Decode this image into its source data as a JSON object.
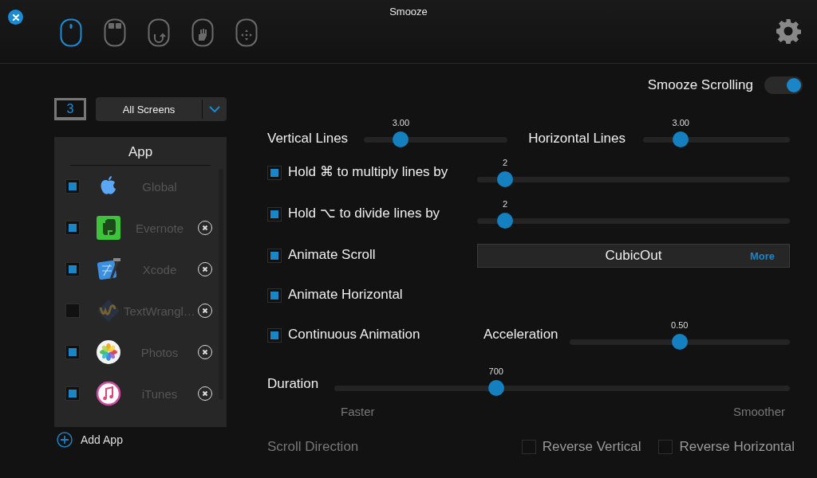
{
  "window": {
    "title": "Smooze"
  },
  "mode_tabs": [
    {
      "kind": "mouse",
      "selected": true
    },
    {
      "kind": "buttons",
      "selected": false
    },
    {
      "kind": "rotate",
      "selected": false
    },
    {
      "kind": "hand",
      "selected": false
    },
    {
      "kind": "move",
      "selected": false
    }
  ],
  "screens": {
    "count": "3",
    "selection": "All Screens"
  },
  "app_list": {
    "header": "App",
    "items": [
      {
        "name": "Global",
        "kind": "apple",
        "checked": true,
        "removable": false
      },
      {
        "name": "Evernote",
        "kind": "evernote",
        "checked": true,
        "removable": true
      },
      {
        "name": "Xcode",
        "kind": "xcode",
        "checked": true,
        "removable": true
      },
      {
        "name": "TextWrangl…",
        "kind": "textwrangler",
        "checked": false,
        "removable": true
      },
      {
        "name": "Photos",
        "kind": "photos",
        "checked": true,
        "removable": true
      },
      {
        "name": "iTunes",
        "kind": "itunes",
        "checked": true,
        "removable": true
      }
    ]
  },
  "add_app": "Add App",
  "smooze_scrolling": {
    "label": "Smooze Scrolling",
    "on": true
  },
  "vertical_lines": {
    "label": "Vertical Lines",
    "reading": "3.00",
    "level": 0.23
  },
  "horizontal_lines": {
    "label": "Horizontal Lines",
    "reading": "3.00",
    "level": 0.23
  },
  "multiply": {
    "label": "Hold ⌘ to multiply lines by",
    "checked": true,
    "reading": "2",
    "level": 0.07
  },
  "divide": {
    "label": "Hold ⌥ to divide lines by",
    "checked": true,
    "reading": "2",
    "level": 0.07
  },
  "animate_scroll": {
    "label": "Animate Scroll",
    "checked": true
  },
  "easing": {
    "value": "CubicOut",
    "more": "More"
  },
  "animate_horizontal": {
    "label": "Animate Horizontal",
    "checked": true
  },
  "continuous_animation": {
    "label": "Continuous Animation",
    "checked": true
  },
  "acceleration": {
    "label": "Acceleration",
    "reading": "0.50",
    "level": 0.5
  },
  "duration": {
    "label": "Duration",
    "reading": "700",
    "level": 0.35,
    "min_label": "Faster",
    "max_label": "Smoother"
  },
  "scroll_direction": {
    "label": "Scroll Direction",
    "options": [
      {
        "label": "Reverse Vertical",
        "checked": false
      },
      {
        "label": "Reverse Horizontal",
        "checked": false
      }
    ]
  }
}
